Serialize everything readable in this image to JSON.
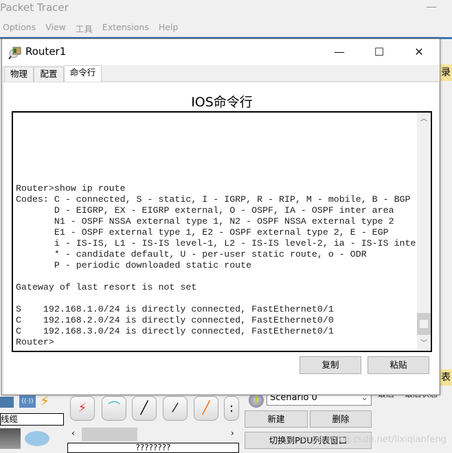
{
  "app": {
    "title": "Packet Tracer",
    "menu": [
      "Options",
      "View",
      "工具",
      "Extensions",
      "Help"
    ]
  },
  "background": {
    "right_tab_1": "录",
    "right_tab_2": "表",
    "right_col_1": "最后",
    "right_col_2": "最后状态"
  },
  "dialog": {
    "title": "Router1",
    "tabs": [
      {
        "label": "物理",
        "active": false
      },
      {
        "label": "配置",
        "active": false
      },
      {
        "label": "命令行",
        "active": true
      }
    ],
    "heading": "IOS命令行",
    "terminal_lines": [
      "Router>show ip route",
      "Codes: C - connected, S - static, I - IGRP, R - RIP, M - mobile, B - BGP",
      "       D - EIGRP, EX - EIGRP external, O - OSPF, IA - OSPF inter area",
      "       N1 - OSPF NSSA external type 1, N2 - OSPF NSSA external type 2",
      "       E1 - OSPF external type 1, E2 - OSPF external type 2, E - EGP",
      "       i - IS-IS, L1 - IS-IS level-1, L2 - IS-IS level-2, ia - IS-IS inte",
      "       * - candidate default, U - per-user static route, o - ODR",
      "       P - periodic downloaded static route",
      "",
      "Gateway of last resort is not set",
      "",
      "S    192.168.1.0/24 is directly connected, FastEthernet0/1",
      "C    192.168.2.0/24 is directly connected, FastEthernet0/0",
      "C    192.168.3.0/24 is directly connected, FastEthernet0/1",
      "Router>"
    ],
    "copy_label": "复制",
    "paste_label": "粘贴"
  },
  "bottom": {
    "cable_label": "线缆",
    "device_status": "????????",
    "scenario": "Scenario 0",
    "new_label": "新建",
    "delete_label": "删除",
    "switch_pdu_label": "切换到PDU列表窗口",
    "watermark": "https://blog.csdn.net/lixiqianfeng"
  },
  "colors": {
    "accent": "#3c78b4",
    "highlight": "#f5e39a"
  }
}
